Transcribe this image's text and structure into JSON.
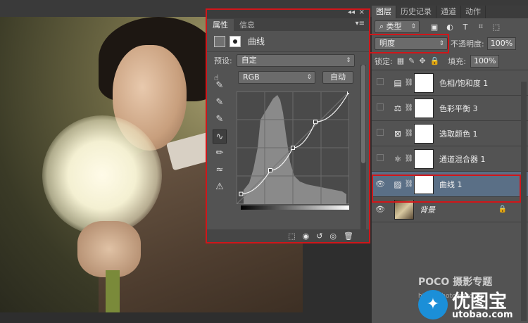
{
  "canvas": {
    "alt": "photo"
  },
  "properties_panel": {
    "tabs": [
      "属性",
      "信息"
    ],
    "collapse_glyph": "◂◂",
    "close_glyph": "×",
    "menu_glyph": "▾≡",
    "adjustment_title": "曲线",
    "preset_label": "预设:",
    "preset_value": "自定",
    "channel_value": "RGB",
    "auto_button": "自动",
    "bottom_icons": [
      "⬚",
      "◉",
      "↺",
      "◎",
      "🗑"
    ]
  },
  "curve": {
    "points": [
      [
        0.04,
        0.09
      ],
      [
        0.3,
        0.3
      ],
      [
        0.5,
        0.5
      ],
      [
        0.7,
        0.73
      ],
      [
        1.0,
        1.0
      ]
    ]
  },
  "layers_panel": {
    "tabs": [
      "图层",
      "历史记录",
      "通道",
      "动作"
    ],
    "filter_label": "类型",
    "blend_mode": "明度",
    "opacity_label": "不透明度:",
    "opacity_value": "100%",
    "lock_label": "锁定:",
    "fill_label": "填充:",
    "fill_value": "100%",
    "layers": [
      {
        "name": "色相/饱和度 1",
        "icon": "hue-saturation"
      },
      {
        "name": "色彩平衡 3",
        "icon": "color-balance"
      },
      {
        "name": "选取颜色 1",
        "icon": "selective-color"
      },
      {
        "name": "通道混合器 1",
        "icon": "channel-mixer"
      },
      {
        "name": "曲线 1",
        "icon": "curves"
      },
      {
        "name": "背景",
        "icon": "background"
      }
    ]
  },
  "watermark": {
    "poco": "POCO 摄影专题",
    "poco_url": "http://photo.poco.cn",
    "brand": "优图宝",
    "url": "utobao.com"
  }
}
